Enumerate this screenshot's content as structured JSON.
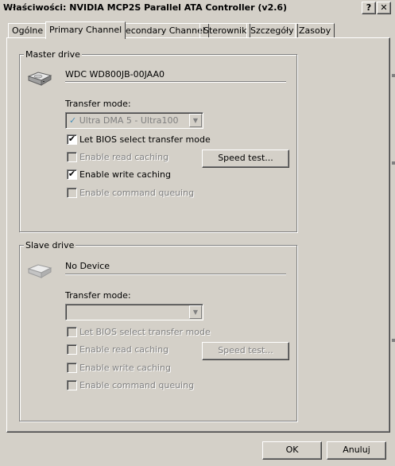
{
  "window": {
    "title": "Właściwości: NVIDIA MCP2S Parallel ATA Controller (v2.6)",
    "help_label": "?",
    "close_label": "✕"
  },
  "tabs": [
    {
      "label": "Ogólne"
    },
    {
      "label": "Primary Channel"
    },
    {
      "label": "Secondary Channel"
    },
    {
      "label": "Sterownik"
    },
    {
      "label": "Szczegóły"
    },
    {
      "label": "Zasoby"
    }
  ],
  "active_tab": "Primary Channel",
  "master": {
    "legend": "Master drive",
    "icon": "hard-drive-icon",
    "device_name": "WDC WD800JB-00JAA0",
    "transfer_mode_label": "Transfer mode:",
    "transfer_mode_value": "Ultra DMA 5 - Ultra100",
    "transfer_mode_check": "✓",
    "let_bios": {
      "label": "Let BIOS select transfer mode",
      "checked": true,
      "enabled": true
    },
    "read_caching": {
      "label": "Enable read caching",
      "checked": false,
      "enabled": false
    },
    "write_caching": {
      "label": "Enable write caching",
      "checked": true,
      "enabled": true
    },
    "command_queuing": {
      "label": "Enable command queuing",
      "checked": false,
      "enabled": false
    },
    "speed_test": {
      "label": "Speed test...",
      "enabled": true
    }
  },
  "slave": {
    "legend": "Slave drive",
    "icon": "hard-drive-icon",
    "device_name": "No Device",
    "transfer_mode_label": "Transfer mode:",
    "transfer_mode_value": "",
    "let_bios": {
      "label": "Let BIOS select transfer mode",
      "checked": false,
      "enabled": false
    },
    "read_caching": {
      "label": "Enable read caching",
      "checked": false,
      "enabled": false
    },
    "write_caching": {
      "label": "Enable write caching",
      "checked": false,
      "enabled": false
    },
    "command_queuing": {
      "label": "Enable command queuing",
      "checked": false,
      "enabled": false
    },
    "speed_test": {
      "label": "Speed test...",
      "enabled": false
    }
  },
  "footer": {
    "ok_label": "OK",
    "cancel_label": "Anuluj"
  },
  "colors": {
    "face": "#d4d0c8",
    "shadow": "#808080",
    "dark": "#404040",
    "highlight": "#ffffff"
  }
}
